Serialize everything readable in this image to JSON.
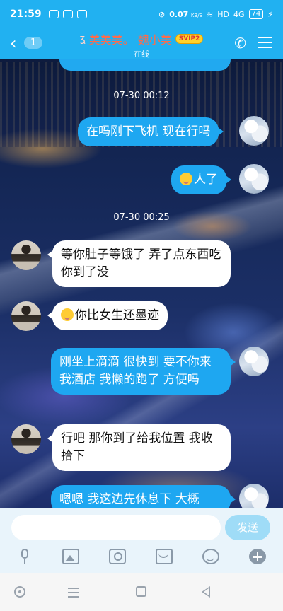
{
  "status_bar": {
    "time": "21:59",
    "net_speed": "0.07",
    "net_unit": "KB/S",
    "hd": "HD",
    "signal": "4G",
    "battery": "74"
  },
  "header": {
    "back_count": "1",
    "title": "美美美。 魏小美",
    "svip_badge": "SVIP2",
    "subtitle": "在线"
  },
  "messages": [
    {
      "type": "timestamp",
      "text": "07-30  00:12"
    },
    {
      "type": "out",
      "text": "在吗刚下飞机 现在行吗"
    },
    {
      "type": "out",
      "text": "人了",
      "emoji": "face-emoji"
    },
    {
      "type": "timestamp",
      "text": "07-30  00:25"
    },
    {
      "type": "in",
      "text": "等你肚子等饿了 弄了点东西吃 你到了没"
    },
    {
      "type": "in",
      "text": "你比女生还墨迹",
      "emoji": "face-emoji"
    },
    {
      "type": "out",
      "text": "刚坐上滴滴 很快到 要不你来我酒店 我懒的跑了 方便吗"
    },
    {
      "type": "in",
      "text": "行吧  那你到了给我位置 我收拾下"
    },
    {
      "type": "out",
      "text": "嗯嗯 我这边先休息下 大概"
    }
  ],
  "input": {
    "placeholder": "",
    "send_label": "发送"
  },
  "toolbar": [
    "mic-icon",
    "image-icon",
    "camera-icon",
    "red-packet-icon",
    "emoji-icon",
    "plus-icon"
  ],
  "colors": {
    "accent": "#21b1f1",
    "bubble_out": "#1ea7f1",
    "bubble_in": "#ffffff",
    "title_name": "#ff6b4a"
  }
}
